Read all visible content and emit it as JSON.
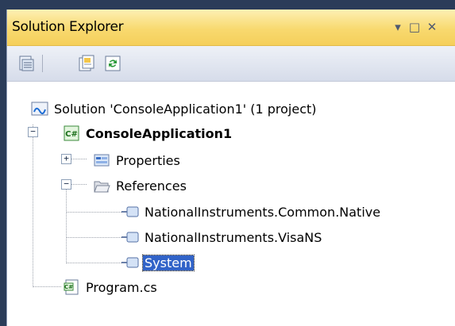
{
  "panel": {
    "title": "Solution Explorer",
    "dropdown_glyph": "▾",
    "maximize_glyph": "□",
    "close_glyph": "✕"
  },
  "toolbar": {
    "icons": [
      "properties-icon",
      "show-all-files-icon",
      "refresh-icon"
    ]
  },
  "tree": {
    "solution": "Solution 'ConsoleApplication1' (1 project)",
    "project": "ConsoleApplication1",
    "properties": "Properties",
    "references": "References",
    "refs": [
      "NationalInstruments.Common.Native",
      "NationalInstruments.VisaNS",
      "System"
    ],
    "program": "Program.cs",
    "expander_plus": "+",
    "expander_minus": "−"
  },
  "colors": {
    "title_gradient": "#f8d96f",
    "selection": "#3163c8"
  }
}
